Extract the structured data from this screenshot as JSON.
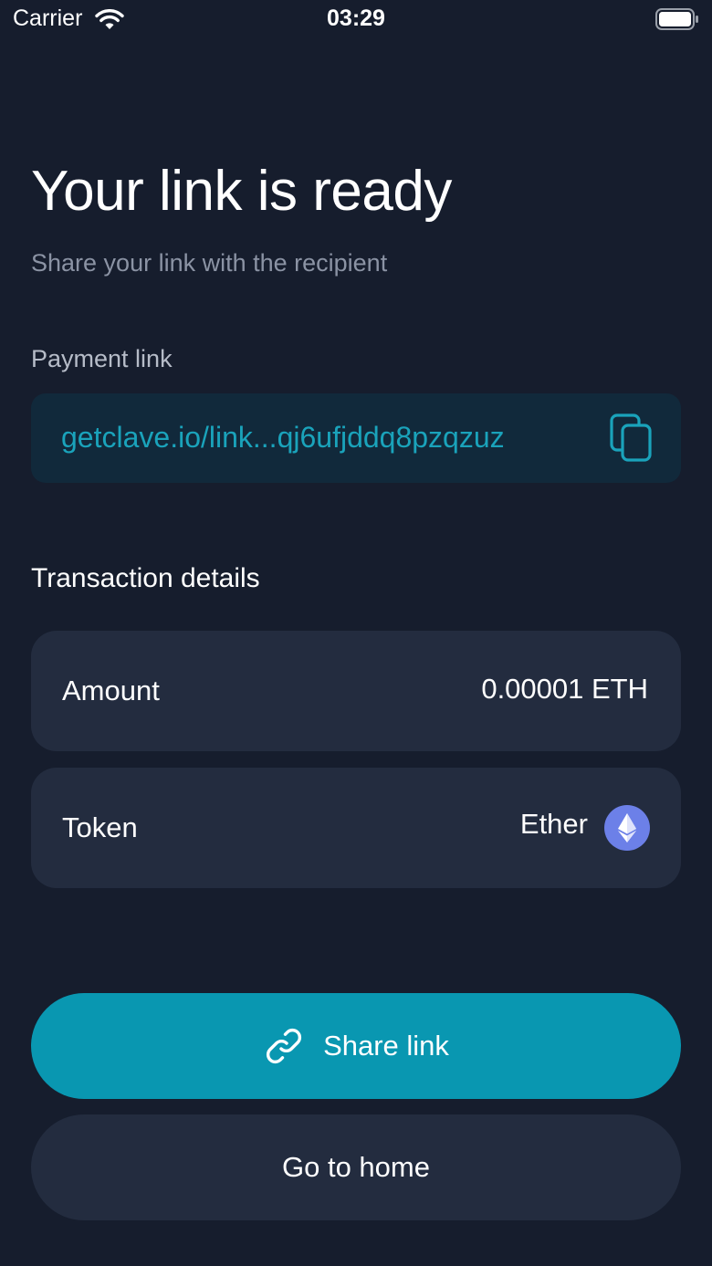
{
  "status_bar": {
    "carrier": "Carrier",
    "time": "03:29",
    "icons": [
      "wifi-icon",
      "battery-icon"
    ]
  },
  "header": {
    "title": "Your link is ready",
    "subtitle": "Share your link with the recipient"
  },
  "payment_link": {
    "label": "Payment link",
    "value": "getclave.io/link...qj6ufjddq8pzqzuz",
    "icon": "copy-icon"
  },
  "transaction": {
    "label": "Transaction details",
    "amount": {
      "label": "Amount",
      "value": "0.00001 ETH"
    },
    "token": {
      "label": "Token",
      "value": "Ether",
      "icon": "ethereum-icon"
    }
  },
  "actions": {
    "share_label": "Share link",
    "share_icon": "link-icon",
    "home_label": "Go to home"
  },
  "colors": {
    "background": "#161d2d",
    "card": "#232c3f",
    "link_box": "#11293b",
    "accent": "#0997b1",
    "link_text": "#1aa3bb",
    "eth_icon": "#6c80e8"
  }
}
